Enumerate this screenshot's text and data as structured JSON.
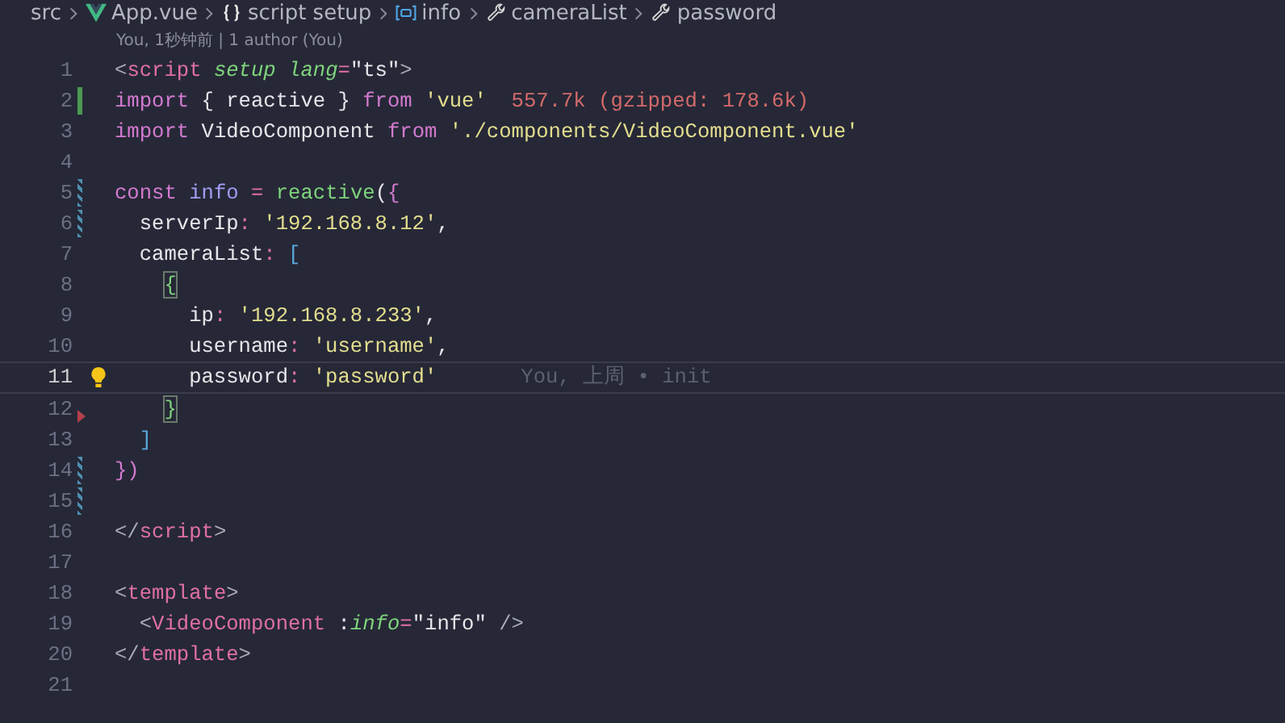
{
  "breadcrumb": [
    {
      "label": "src",
      "kind": "folder"
    },
    {
      "label": "App.vue",
      "kind": "vue"
    },
    {
      "label": "script setup",
      "kind": "braces"
    },
    {
      "label": "info",
      "kind": "variable"
    },
    {
      "label": "cameraList",
      "kind": "property"
    },
    {
      "label": "password",
      "kind": "property"
    }
  ],
  "codelens": "You, 1秒钟前 | 1 author (You)",
  "lines": [
    {
      "number": "1",
      "current": false,
      "tokens": [
        {
          "text": "<",
          "kind": "punct"
        },
        {
          "text": "script",
          "kind": "tag"
        },
        {
          "text": " setup",
          "kind": "attr"
        },
        {
          "text": " lang",
          "kind": "attr"
        },
        {
          "text": "=",
          "kind": "op"
        },
        {
          "text": "\"ts\"",
          "kind": "plain"
        },
        {
          "text": ">",
          "kind": "punct"
        }
      ]
    },
    {
      "number": "2",
      "current": false,
      "gutter": {
        "kind": "added"
      },
      "tokens": [
        {
          "text": "import",
          "kind": "keyword"
        },
        {
          "text": " { reactive } ",
          "kind": "plain"
        },
        {
          "text": "from",
          "kind": "keyword"
        },
        {
          "text": " 'vue'",
          "kind": "string"
        },
        {
          "text": "  557.7k (gzipped: 178.6k)",
          "kind": "hint"
        }
      ]
    },
    {
      "number": "3",
      "current": false,
      "tokens": [
        {
          "text": "import",
          "kind": "keyword"
        },
        {
          "text": " VideoComponent ",
          "kind": "plain"
        },
        {
          "text": "from",
          "kind": "keyword"
        },
        {
          "text": " './components/VideoComponent.vue'",
          "kind": "string"
        }
      ]
    },
    {
      "number": "4",
      "current": false
    },
    {
      "number": "5",
      "current": false,
      "gutter": {
        "kind": "modified"
      },
      "tokens": [
        {
          "text": "const",
          "kind": "keyword"
        },
        {
          "text": " info",
          "kind": "variable"
        },
        {
          "text": " =",
          "kind": "op"
        },
        {
          "text": " reactive",
          "kind": "function"
        },
        {
          "text": "(",
          "kind": "plain"
        },
        {
          "text": "{",
          "kind": "keyword"
        }
      ]
    },
    {
      "number": "6",
      "current": false,
      "gutter": {
        "kind": "modified"
      },
      "tokens": [
        {
          "text": "  serverIp",
          "kind": "plain"
        },
        {
          "text": ": ",
          "kind": "op"
        },
        {
          "text": "'192.168.8.12'",
          "kind": "string"
        },
        {
          "text": ",",
          "kind": "plain"
        }
      ]
    },
    {
      "number": "7",
      "current": false,
      "tokens": [
        {
          "text": "  cameraList",
          "kind": "plain"
        },
        {
          "text": ": ",
          "kind": "op"
        },
        {
          "text": "[",
          "kind": "bracket"
        }
      ]
    },
    {
      "number": "8",
      "current": false,
      "tokens": [
        {
          "text": "    {",
          "kind": "match"
        }
      ]
    },
    {
      "number": "9",
      "current": false,
      "tokens": [
        {
          "text": "      ip",
          "kind": "plain"
        },
        {
          "text": ": ",
          "kind": "op"
        },
        {
          "text": "'192.168.8.233'",
          "kind": "string"
        },
        {
          "text": ",",
          "kind": "plain"
        }
      ]
    },
    {
      "number": "10",
      "current": false,
      "tokens": [
        {
          "text": "      username",
          "kind": "plain"
        },
        {
          "text": ": ",
          "kind": "op"
        },
        {
          "text": "'username'",
          "kind": "string"
        },
        {
          "text": ",",
          "kind": "plain"
        }
      ]
    },
    {
      "number": "11",
      "current": true,
      "lightbulb": true,
      "blame": "You, 上周 • init",
      "tokens": [
        {
          "text": "      password",
          "kind": "plain"
        },
        {
          "text": ": ",
          "kind": "op"
        },
        {
          "text": "'password'",
          "kind": "string"
        }
      ]
    },
    {
      "number": "12",
      "current": false,
      "gutter": {
        "kind": "deleted"
      },
      "tokens": [
        {
          "text": "    }",
          "kind": "match"
        }
      ]
    },
    {
      "number": "13",
      "current": false,
      "tokens": [
        {
          "text": "  ]",
          "kind": "bracket"
        }
      ]
    },
    {
      "number": "14",
      "current": false,
      "gutter": {
        "kind": "modified"
      },
      "tokens": [
        {
          "text": "})",
          "kind": "keyword"
        }
      ]
    },
    {
      "number": "15",
      "current": false,
      "gutter": {
        "kind": "modified"
      }
    },
    {
      "number": "16",
      "current": false,
      "tokens": [
        {
          "text": "</",
          "kind": "punct"
        },
        {
          "text": "script",
          "kind": "tag"
        },
        {
          "text": ">",
          "kind": "punct"
        }
      ]
    },
    {
      "number": "17",
      "current": false
    },
    {
      "number": "18",
      "current": false,
      "tokens": [
        {
          "text": "<",
          "kind": "punct"
        },
        {
          "text": "template",
          "kind": "tag"
        },
        {
          "text": ">",
          "kind": "punct"
        }
      ]
    },
    {
      "number": "19",
      "current": false,
      "tokens": [
        {
          "text": "  <",
          "kind": "punct"
        },
        {
          "text": "VideoComponent",
          "kind": "tag"
        },
        {
          "text": " :",
          "kind": "plain"
        },
        {
          "text": "info",
          "kind": "attr"
        },
        {
          "text": "=",
          "kind": "op"
        },
        {
          "text": "\"info\"",
          "kind": "plain"
        },
        {
          "text": " />",
          "kind": "punct"
        }
      ]
    },
    {
      "number": "20",
      "current": false,
      "tokens": [
        {
          "text": "</",
          "kind": "punct"
        },
        {
          "text": "template",
          "kind": "tag"
        },
        {
          "text": ">",
          "kind": "punct"
        }
      ]
    },
    {
      "number": "21",
      "current": false
    }
  ]
}
